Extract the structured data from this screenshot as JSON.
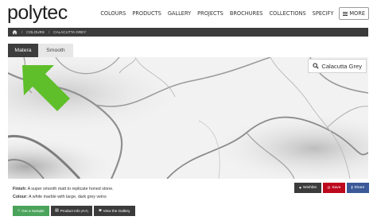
{
  "brand": {
    "logo_text": "polytec"
  },
  "nav": {
    "items": [
      "COLOURS",
      "PRODUCTS",
      "GALLERY",
      "PROJECTS",
      "BROCHURES",
      "COLLECTIONS",
      "SPECIFY"
    ],
    "more_label": "MORE"
  },
  "breadcrumb": {
    "items": [
      "COLOURS",
      "CALACUTTA GREY"
    ]
  },
  "tabs": [
    {
      "label": "Matera",
      "active": true
    },
    {
      "label": "Smooth",
      "active": false
    }
  ],
  "swatch": {
    "name": "Calacutta Grey"
  },
  "details": {
    "finish_label": "Finish:",
    "finish_text": "A super smooth matt to replicate honed stone.",
    "colour_label": "Colour:",
    "colour_text": "A white marble with large, dark grey veins"
  },
  "share": {
    "wishlist_label": "Wishlist",
    "save_label": "Save",
    "facebook_label": "Share"
  },
  "actions": {
    "sample_label": "Get a Sample",
    "product_info_label": "Product Info",
    "product_info_suffix": "(PDF)",
    "gallery_label": "View the Gallery"
  },
  "colors": {
    "accent_green": "#5fbf2a",
    "sample_green": "#4aa35a",
    "dark_bar": "#3b3b3b",
    "pinterest_red": "#bd081c",
    "facebook_blue": "#3b5998"
  }
}
